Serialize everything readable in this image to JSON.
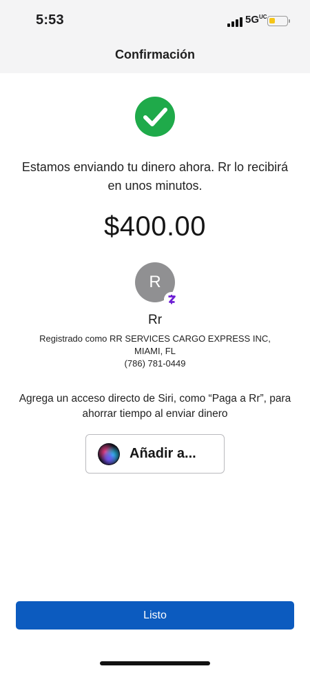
{
  "status_bar": {
    "time": "5:53",
    "network": "5G",
    "network_sub": "UC",
    "battery_level": 0.35,
    "battery_color": "#f5c518"
  },
  "header": {
    "title": "Confirmación"
  },
  "success": {
    "icon": "check-circle-icon",
    "color": "#1faa4a",
    "message": "Estamos enviando tu dinero ahora. Rr lo recibirá en unos minutos."
  },
  "payment": {
    "amount": "$400.00"
  },
  "recipient": {
    "initial": "R",
    "badge_icon": "zelle-icon",
    "badge_color": "#6d1ed4",
    "name": "Rr",
    "registered_line1": "Registrado como RR SERVICES CARGO EXPRESS INC,",
    "registered_line2": "MIAMI, FL",
    "phone": "(786) 781-0449"
  },
  "siri": {
    "prompt": "Agrega un acceso directo de Siri, como “Paga a Rr”, para ahorrar tiempo al enviar dinero",
    "button_label": "Añadir a...",
    "icon": "siri-icon"
  },
  "footer": {
    "done_label": "Listo",
    "accent_color": "#0c5bbf"
  }
}
